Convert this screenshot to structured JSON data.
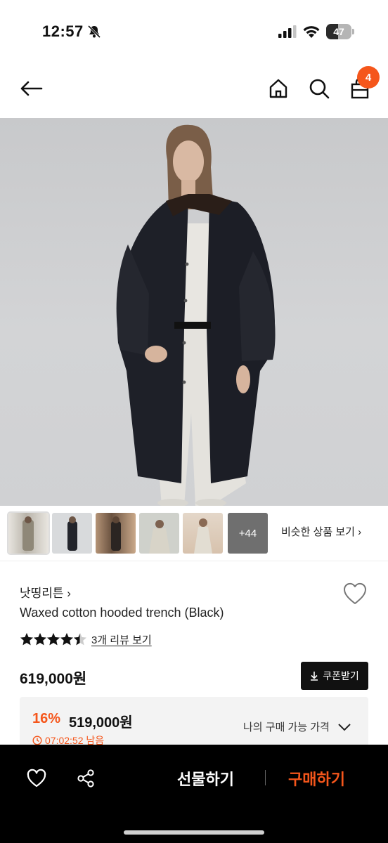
{
  "status": {
    "time": "12:57",
    "battery_level": "47",
    "battery_fraction": 0.47
  },
  "nav": {
    "cart_count": "4",
    "icons": [
      "back-arrow-icon",
      "home-icon",
      "search-icon",
      "cart-icon"
    ]
  },
  "gallery": {
    "more_count": "+44",
    "similar_link": "비슷한 상품 보기 ›"
  },
  "product": {
    "brand": "낫띵리튼 ›",
    "title": "Waxed cotton hooded trench (Black)",
    "rating_fraction": 0.9,
    "review_link": "3개 리뷰 보기",
    "price": "619,000원",
    "coupon_label": "쿠폰받기"
  },
  "benefit": {
    "discount_rate": "16%",
    "discount_price": "519,000원",
    "my_price_label": "나의 구매 가능 가격",
    "timer": "07:02:52 남음"
  },
  "bottom_bar": {
    "gift_label": "선물하기",
    "buy_label": "구매하기"
  },
  "colors": {
    "accent": "#f5561b",
    "bottom_bar_bg": "#000000",
    "coupon_bg": "#111111"
  }
}
